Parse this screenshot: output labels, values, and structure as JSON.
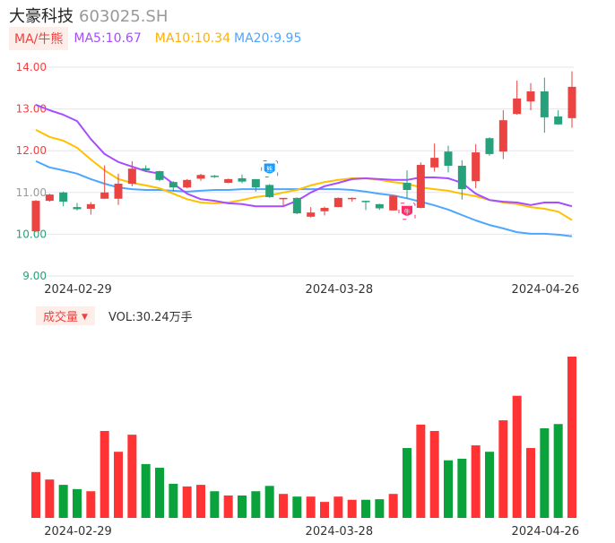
{
  "header": {
    "name": "大豪科技",
    "code": "603025.SH"
  },
  "legend": {
    "tag": "MA/牛熊",
    "ma5": "MA5:10.67",
    "ma10": "MA10:10.34",
    "ma20": "MA20:9.95"
  },
  "volume_legend": {
    "tag": "成交量",
    "arrow": "▼",
    "vol": "VOL:30.24万手"
  },
  "colors": {
    "up": "#eb4242",
    "down": "#26a17b",
    "ma5": "#a64dff",
    "ma10": "#ffc000",
    "ma20": "#4da6ff",
    "bull_badge": "#ff2d6b",
    "bear_badge": "#1a9bff"
  },
  "badges": [
    {
      "label": "熊",
      "index": 17,
      "kind": "bear"
    },
    {
      "label": "牛",
      "index": 27,
      "kind": "bull"
    }
  ],
  "chart_data": {
    "type": "candlestick",
    "price_axis": {
      "ylim": [
        9,
        14
      ],
      "ticks": [
        "14.00",
        "13.00",
        "12.00",
        "11.00",
        "10.00",
        "9.00"
      ]
    },
    "x_ticks": [
      {
        "index": 0,
        "label": "2024-02-29"
      },
      {
        "index": 19,
        "label": "2024-03-28"
      },
      {
        "index": 34,
        "label": "2024-04-26"
      }
    ],
    "ohlc": [
      [
        10.07,
        10.82,
        10.05,
        10.8
      ],
      [
        10.8,
        10.97,
        10.78,
        10.95
      ],
      [
        11.0,
        11.02,
        10.67,
        10.78
      ],
      [
        10.65,
        10.75,
        10.57,
        10.6
      ],
      [
        10.61,
        10.77,
        10.47,
        10.72
      ],
      [
        10.85,
        11.65,
        10.85,
        11.0
      ],
      [
        10.85,
        11.45,
        10.7,
        11.21
      ],
      [
        11.21,
        11.75,
        11.15,
        11.57
      ],
      [
        11.58,
        11.65,
        11.5,
        11.53
      ],
      [
        11.51,
        11.52,
        11.27,
        11.3
      ],
      [
        11.25,
        11.27,
        11.02,
        11.12
      ],
      [
        11.12,
        11.32,
        11.1,
        11.3
      ],
      [
        11.33,
        11.45,
        11.28,
        11.42
      ],
      [
        11.4,
        11.42,
        11.35,
        11.37
      ],
      [
        11.23,
        11.33,
        11.22,
        11.32
      ],
      [
        11.34,
        11.43,
        11.22,
        11.26
      ],
      [
        11.32,
        11.32,
        11.02,
        11.12
      ],
      [
        11.18,
        11.2,
        10.87,
        10.89
      ],
      [
        10.85,
        10.87,
        10.68,
        10.87
      ],
      [
        10.87,
        10.88,
        10.48,
        10.5
      ],
      [
        10.42,
        10.65,
        10.4,
        10.52
      ],
      [
        10.55,
        10.66,
        10.45,
        10.63
      ],
      [
        10.65,
        10.88,
        10.65,
        10.87
      ],
      [
        10.85,
        10.88,
        10.78,
        10.87
      ],
      [
        10.8,
        10.8,
        10.58,
        10.78
      ],
      [
        10.72,
        10.73,
        10.58,
        10.62
      ],
      [
        10.57,
        10.93,
        10.57,
        10.92
      ],
      [
        11.23,
        11.53,
        10.85,
        11.06
      ],
      [
        10.63,
        11.72,
        10.62,
        11.66
      ],
      [
        11.6,
        12.17,
        11.5,
        11.83
      ],
      [
        11.98,
        12.12,
        11.48,
        11.64
      ],
      [
        11.64,
        11.77,
        10.83,
        11.08
      ],
      [
        11.27,
        12.16,
        11.1,
        11.96
      ],
      [
        12.3,
        12.32,
        11.88,
        11.92
      ],
      [
        11.98,
        12.97,
        11.8,
        12.73
      ],
      [
        12.88,
        13.68,
        12.86,
        13.25
      ],
      [
        13.18,
        13.62,
        12.97,
        13.42
      ],
      [
        13.42,
        13.75,
        12.43,
        12.8
      ],
      [
        12.82,
        12.97,
        12.62,
        12.63
      ],
      [
        12.78,
        13.9,
        12.55,
        13.53
      ]
    ],
    "ma5": [
      13.1,
      12.97,
      12.86,
      12.71,
      12.28,
      11.92,
      11.73,
      11.62,
      11.51,
      11.45,
      11.21,
      10.97,
      10.84,
      10.8,
      10.74,
      10.72,
      10.67,
      10.67,
      10.67,
      10.8,
      11.0,
      11.15,
      11.23,
      11.32,
      11.34,
      11.32,
      11.3,
      11.3,
      11.36,
      11.36,
      11.34,
      11.23,
      10.97,
      10.82,
      10.78,
      10.76,
      10.7,
      10.76,
      10.76,
      10.67
    ],
    "ma10": [
      12.5,
      12.33,
      12.24,
      12.07,
      11.79,
      11.53,
      11.32,
      11.23,
      11.17,
      11.1,
      10.97,
      10.84,
      10.76,
      10.74,
      10.76,
      10.82,
      10.89,
      10.93,
      11.0,
      11.06,
      11.17,
      11.25,
      11.3,
      11.34,
      11.34,
      11.3,
      11.25,
      11.21,
      11.12,
      11.08,
      11.04,
      10.97,
      10.91,
      10.82,
      10.76,
      10.72,
      10.65,
      10.61,
      10.54,
      10.34
    ],
    "ma20": [
      11.75,
      11.6,
      11.53,
      11.45,
      11.32,
      11.21,
      11.12,
      11.08,
      11.06,
      11.06,
      11.04,
      11.02,
      11.04,
      11.06,
      11.06,
      11.08,
      11.08,
      11.08,
      11.08,
      11.08,
      11.08,
      11.08,
      11.08,
      11.06,
      11.02,
      10.97,
      10.93,
      10.86,
      10.78,
      10.69,
      10.59,
      10.46,
      10.33,
      10.22,
      10.14,
      10.05,
      10.01,
      10.01,
      9.99,
      9.95
    ],
    "volume_unit": "万手",
    "volume": [
      8.6,
      7.2,
      6.2,
      5.4,
      5.0,
      16.3,
      12.4,
      15.6,
      10.1,
      9.4,
      6.4,
      5.9,
      6.2,
      5.0,
      4.2,
      4.2,
      5.0,
      6.0,
      4.5,
      4.0,
      4.0,
      3.0,
      4.0,
      3.4,
      3.4,
      3.5,
      4.5,
      13.1,
      17.5,
      16.3,
      10.8,
      11.1,
      13.6,
      12.4,
      18.3,
      22.9,
      13.1,
      16.8,
      17.6,
      30.24
    ]
  }
}
